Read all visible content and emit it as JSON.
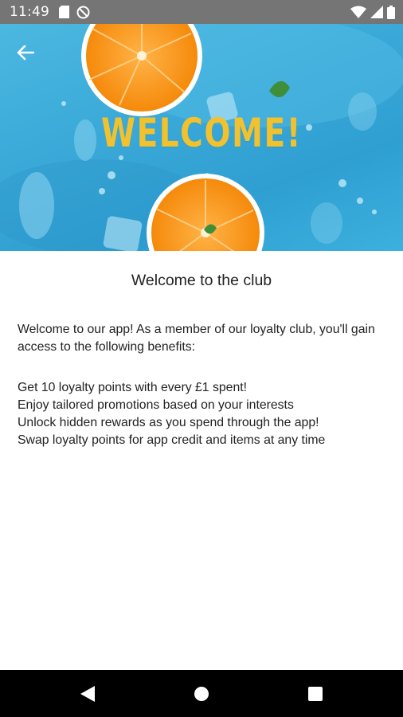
{
  "status_bar": {
    "time": "11:49",
    "left_icons": [
      "sd-card-icon",
      "no-data-saver-icon"
    ],
    "right_icons": [
      "wifi-icon",
      "signal-icon",
      "battery-icon"
    ]
  },
  "hero": {
    "title": "WELCOME!",
    "back_icon": "arrow-back-icon"
  },
  "content": {
    "title": "Welcome to the club",
    "intro": "Welcome to our app! As a member of our loyalty club, you'll gain access to the following benefits:",
    "benefits": [
      "Get 10 loyalty points with every £1 spent!",
      "Enjoy tailored promotions based on your interests",
      "Unlock hidden rewards as you spend through the app!",
      "Swap loyalty points for app credit and items at any time"
    ]
  },
  "nav_bar": {
    "buttons": [
      "back-triangle-icon",
      "home-circle-icon",
      "recents-square-icon"
    ]
  },
  "colors": {
    "status_bar": "#757575",
    "hero_title": "#f2c12e",
    "hero_bg": "#3aa9d8",
    "orange": "#f39a1e",
    "nav_bar": "#000000"
  }
}
